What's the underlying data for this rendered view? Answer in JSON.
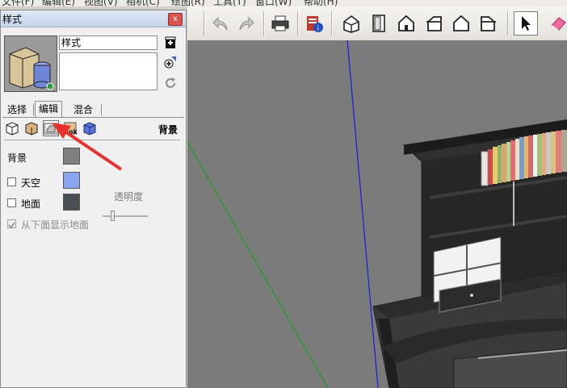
{
  "menu": [
    "文件(F)",
    "编辑(E)",
    "视图(V)",
    "相机(C)",
    "绘图(R)",
    "工具(T)",
    "窗口(W)",
    "帮助(H)"
  ],
  "toolbar": {
    "icons": [
      "undo-icon",
      "redo-icon",
      "print-icon",
      "model-info-icon",
      "iso-view-icon",
      "top-view-icon",
      "front-view-icon",
      "right-view-icon",
      "back-view-icon",
      "left-view-icon",
      "select-icon",
      "eraser-icon"
    ],
    "selected": "select-icon"
  },
  "panel": {
    "title": "样式",
    "close_label": "x",
    "style_name": "样式",
    "style_description": "",
    "tabs": [
      "选择",
      "编辑",
      "混合"
    ],
    "active_tab": "编辑",
    "section_title": "背景",
    "settings": {
      "background_label": "背景",
      "background_color": "#808080",
      "sky_label": "天空",
      "sky_checked": false,
      "sky_color": "#8ba6f0",
      "ground_label": "地面",
      "ground_checked": false,
      "ground_color": "#4a4f55",
      "transparency_label": "透明度",
      "show_ground_label": "从下面显示地面",
      "show_ground_checked": true,
      "transparency_level": 0.2
    }
  },
  "annotation": {
    "arrow_color": "#e8322f",
    "target": "background-settings-icon"
  }
}
